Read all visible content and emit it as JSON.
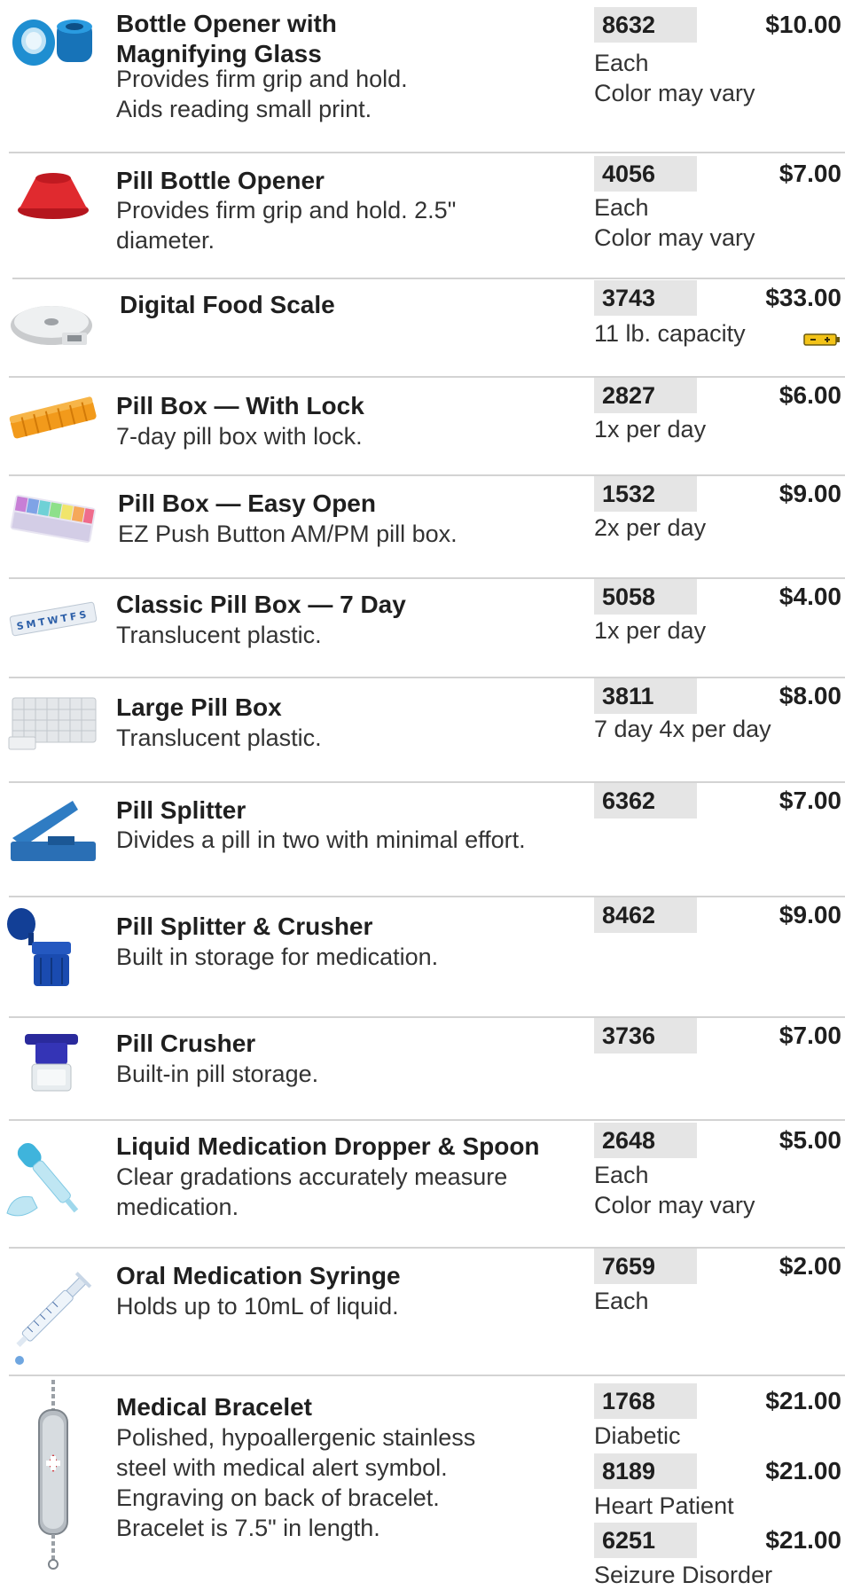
{
  "products": [
    {
      "title_lines": [
        "Bottle Opener with",
        "Magnifying Glass"
      ],
      "desc_lines": [
        "Provides firm grip and hold.",
        "Aids reading small print."
      ],
      "variants": [
        {
          "sku": "8632",
          "price": "$10.00",
          "notes": [
            "Each",
            "Color may vary"
          ]
        }
      ],
      "icon": "bottle-opener-magnifier-icon"
    },
    {
      "title_lines": [
        "Pill Bottle Opener"
      ],
      "desc_lines": [
        "Provides firm grip and hold. 2.5\"",
        "diameter."
      ],
      "variants": [
        {
          "sku": "4056",
          "price": "$7.00",
          "notes": [
            "Each",
            "Color may vary"
          ]
        }
      ],
      "icon": "pill-bottle-opener-icon"
    },
    {
      "title_lines": [
        "Digital Food Scale"
      ],
      "desc_lines": [],
      "variants": [
        {
          "sku": "3743",
          "price": "$33.00",
          "notes": [
            "11 lb. capacity"
          ]
        }
      ],
      "icon": "food-scale-icon",
      "extra_icon": "battery-icon"
    },
    {
      "title_lines": [
        "Pill Box — With Lock"
      ],
      "desc_lines": [
        "7-day pill box with lock."
      ],
      "variants": [
        {
          "sku": "2827",
          "price": "$6.00",
          "notes": [
            "1x per day"
          ]
        }
      ],
      "icon": "pill-box-lock-icon"
    },
    {
      "title_lines": [
        "Pill Box — Easy Open"
      ],
      "desc_lines": [
        "EZ Push Button AM/PM pill box."
      ],
      "variants": [
        {
          "sku": "1532",
          "price": "$9.00",
          "notes": [
            "2x per day"
          ]
        }
      ],
      "icon": "pill-box-easy-open-icon"
    },
    {
      "title_lines": [
        "Classic Pill Box — 7 Day"
      ],
      "desc_lines": [
        "Translucent plastic."
      ],
      "variants": [
        {
          "sku": "5058",
          "price": "$4.00",
          "notes": [
            "1x per day"
          ]
        }
      ],
      "icon": "classic-pill-box-icon",
      "icon_text": "SMTWTFS"
    },
    {
      "title_lines": [
        "Large Pill Box"
      ],
      "desc_lines": [
        "Translucent plastic."
      ],
      "variants": [
        {
          "sku": "3811",
          "price": "$8.00",
          "notes": [
            "7 day 4x per day"
          ]
        }
      ],
      "icon": "large-pill-box-icon"
    },
    {
      "title_lines": [
        "Pill Splitter"
      ],
      "desc_lines": [
        "Divides a pill in two with minimal effort."
      ],
      "variants": [
        {
          "sku": "6362",
          "price": "$7.00",
          "notes": []
        }
      ],
      "icon": "pill-splitter-icon"
    },
    {
      "title_lines": [
        "Pill Splitter & Crusher"
      ],
      "desc_lines": [
        "Built in storage for medication."
      ],
      "variants": [
        {
          "sku": "8462",
          "price": "$9.00",
          "notes": []
        }
      ],
      "icon": "pill-splitter-crusher-icon"
    },
    {
      "title_lines": [
        "Pill Crusher"
      ],
      "desc_lines": [
        "Built-in pill storage."
      ],
      "variants": [
        {
          "sku": "3736",
          "price": "$7.00",
          "notes": []
        }
      ],
      "icon": "pill-crusher-icon"
    },
    {
      "title_lines": [
        "Liquid Medication Dropper & Spoon"
      ],
      "desc_lines": [
        "Clear gradations accurately measure",
        "medication."
      ],
      "variants": [
        {
          "sku": "2648",
          "price": "$5.00",
          "notes": [
            "Each",
            "Color may vary"
          ]
        }
      ],
      "icon": "dropper-spoon-icon"
    },
    {
      "title_lines": [
        "Oral Medication Syringe"
      ],
      "desc_lines": [
        "Holds up to 10mL of liquid."
      ],
      "variants": [
        {
          "sku": "7659",
          "price": "$2.00",
          "notes": [
            "Each"
          ]
        }
      ],
      "icon": "oral-syringe-icon"
    },
    {
      "title_lines": [
        "Medical Bracelet"
      ],
      "desc_lines": [
        "Polished, hypoallergenic stainless",
        "steel with medical alert symbol.",
        "Engraving on back of bracelet.",
        "Bracelet is 7.5\" in length."
      ],
      "variants": [
        {
          "sku": "1768",
          "price": "$21.00",
          "notes": [
            "Diabetic"
          ]
        },
        {
          "sku": "8189",
          "price": "$21.00",
          "notes": [
            "Heart Patient"
          ]
        },
        {
          "sku": "6251",
          "price": "$21.00",
          "notes": [
            "Seizure Disorder"
          ]
        }
      ],
      "icon": "medical-bracelet-icon"
    }
  ]
}
